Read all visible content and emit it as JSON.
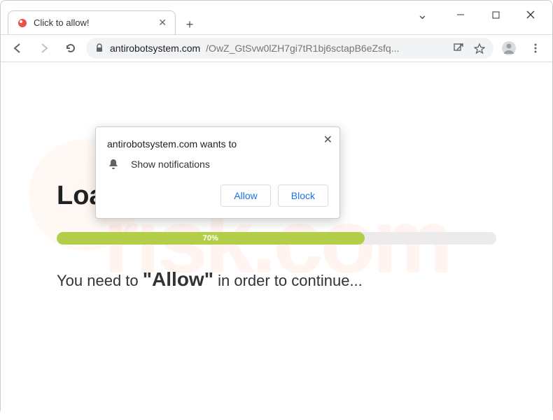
{
  "window": {
    "tab_title": "Click to allow!",
    "chevron": "⌄"
  },
  "toolbar": {
    "url_domain": "antirobotsystem.com",
    "url_path": "/OwZ_GtSvw0lZH7gi7tR1bj6sctapB6eZsfq..."
  },
  "permission": {
    "origin_line": "antirobotsystem.com wants to",
    "item": "Show notifications",
    "allow": "Allow",
    "block": "Block"
  },
  "page": {
    "loading": "Loading...",
    "progress_percent": 70,
    "progress_label": "70%",
    "instr_prefix": "You need to ",
    "instr_quote": "\"Allow\"",
    "instr_suffix": " in order to continue..."
  },
  "watermark": {
    "text": "risk.com"
  }
}
